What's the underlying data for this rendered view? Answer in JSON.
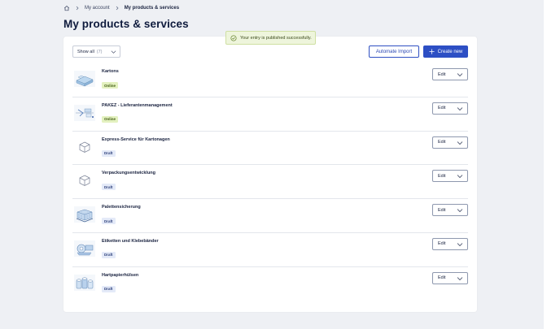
{
  "breadcrumb": {
    "home_icon": "home-icon",
    "items": [
      "My account",
      "My products & services"
    ]
  },
  "page": {
    "title": "My products & services"
  },
  "toast": {
    "message": "Your entry is published successfully.",
    "icon": "check-circle-icon",
    "color": "#eef5dc"
  },
  "toolbar": {
    "filter_label": "Show all",
    "filter_count": "(7)",
    "import_label": "Automate Import",
    "create_label": "Create new",
    "accent": "#2d4fc4"
  },
  "products": [
    {
      "title": "Kartons",
      "status": "Online",
      "status_type": "online",
      "thumb": "cardboard-box-image",
      "edit_label": "Edit"
    },
    {
      "title": "PAKEZ - Lieferantenmanagement",
      "status": "Online",
      "status_type": "online",
      "thumb": "supplier-management-image",
      "edit_label": "Edit"
    },
    {
      "title": "Express-Service für Kartonagen",
      "status": "Draft",
      "status_type": "draft",
      "thumb": "box-placeholder-icon",
      "edit_label": "Edit"
    },
    {
      "title": "Verpackungsentwicklung",
      "status": "Draft",
      "status_type": "draft",
      "thumb": "box-placeholder-icon",
      "edit_label": "Edit"
    },
    {
      "title": "Palettensicherung",
      "status": "Draft",
      "status_type": "draft",
      "thumb": "pallet-image",
      "edit_label": "Edit"
    },
    {
      "title": "Etiketten und Klebebänder",
      "status": "Draft",
      "status_type": "draft",
      "thumb": "labels-tape-image",
      "edit_label": "Edit"
    },
    {
      "title": "Hartpapierhülsen",
      "status": "Draft",
      "status_type": "draft",
      "thumb": "paper-tubes-image",
      "edit_label": "Edit"
    }
  ]
}
